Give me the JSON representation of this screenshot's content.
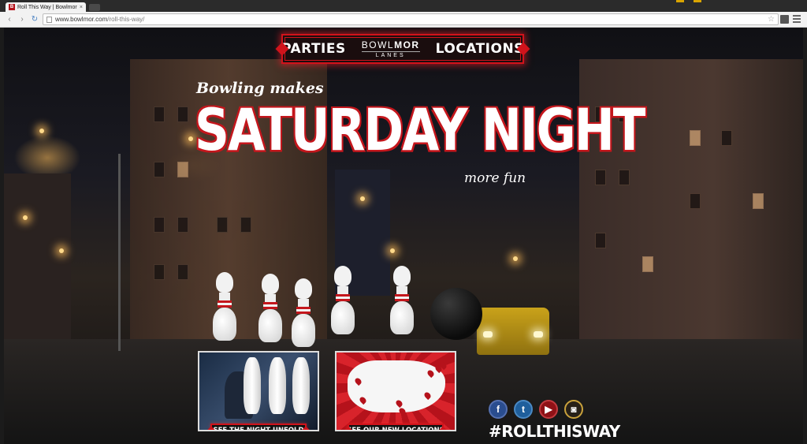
{
  "browser": {
    "tab_title": "Roll This Way | Bowlmor",
    "tab_close": "×",
    "url_host": "www.bowlmor.com",
    "url_path": "/roll-this-way/",
    "back": "‹",
    "forward": "›",
    "reload": "↻",
    "star": "☆"
  },
  "nav": {
    "parties": "PARTIES",
    "logo_brand_a": "BOWL",
    "logo_brand_b": "MOR",
    "logo_sub": "LANES",
    "locations": "LOCATIONS"
  },
  "hero": {
    "tagline_top": "Bowling makes",
    "headline": "SATURDAY NIGHT",
    "tagline_bottom": "more fun"
  },
  "promos": [
    {
      "label": "SEE THE NIGHT UNFOLD"
    },
    {
      "label": "SEE OUR NEW LOCATIONS"
    }
  ],
  "social": {
    "facebook": "f",
    "twitter": "t",
    "youtube": "▶",
    "instagram": "◙",
    "hashtag": "#ROLLTHISWAY"
  },
  "colors": {
    "brand_red": "#d0131b",
    "nav_bg": "#1a0d0e"
  },
  "icons": [
    "favicon-icon",
    "back-icon",
    "forward-icon",
    "reload-icon",
    "page-icon",
    "star-icon",
    "extension-icon",
    "menu-icon",
    "facebook-icon",
    "twitter-icon",
    "youtube-icon",
    "instagram-icon"
  ]
}
